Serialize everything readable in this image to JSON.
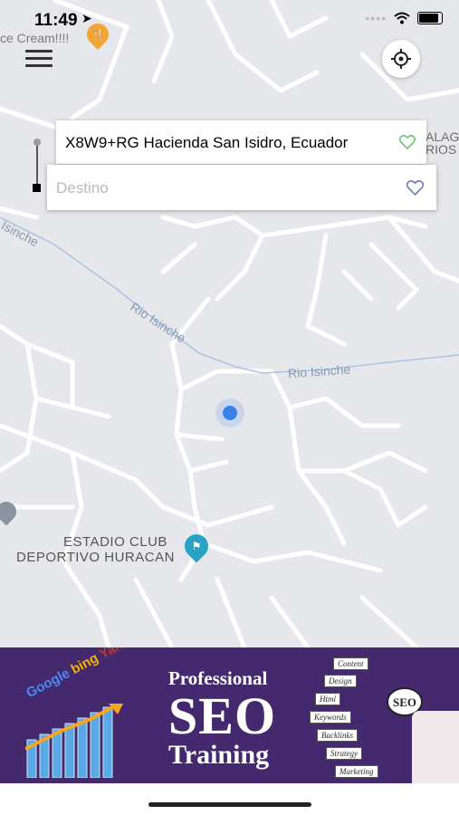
{
  "status_bar": {
    "time": "11:49"
  },
  "map": {
    "poi_ice_cream": "ce Cream!!!!",
    "poi_partial_right": [
      "ALAG",
      "RIOS"
    ],
    "river_labels": [
      "Rio Isinche",
      "Rio Isinche",
      "Isinche"
    ],
    "stadium_lines": [
      "ESTADIO CLUB",
      "DEPORTIVO HURACAN"
    ]
  },
  "route": {
    "origin": "X8W9+RG Hacienda San Isidro, Ecuador",
    "destination_placeholder": "Destino"
  },
  "ad": {
    "line1": "Professional",
    "line2": "SEO",
    "line3": "Training",
    "brands": [
      "Google",
      "bing",
      "Yahoo!"
    ],
    "keywords": [
      "Content",
      "Design",
      "Html",
      "Keywords",
      "Backlinks",
      "Strategy",
      "Marketing"
    ],
    "badge": "SEO"
  },
  "colors": {
    "accent_blue": "#3b82e8",
    "ad_bg": "#44296e",
    "heart_green": "#6cc26c",
    "heart_blue": "#6e7fb8"
  }
}
